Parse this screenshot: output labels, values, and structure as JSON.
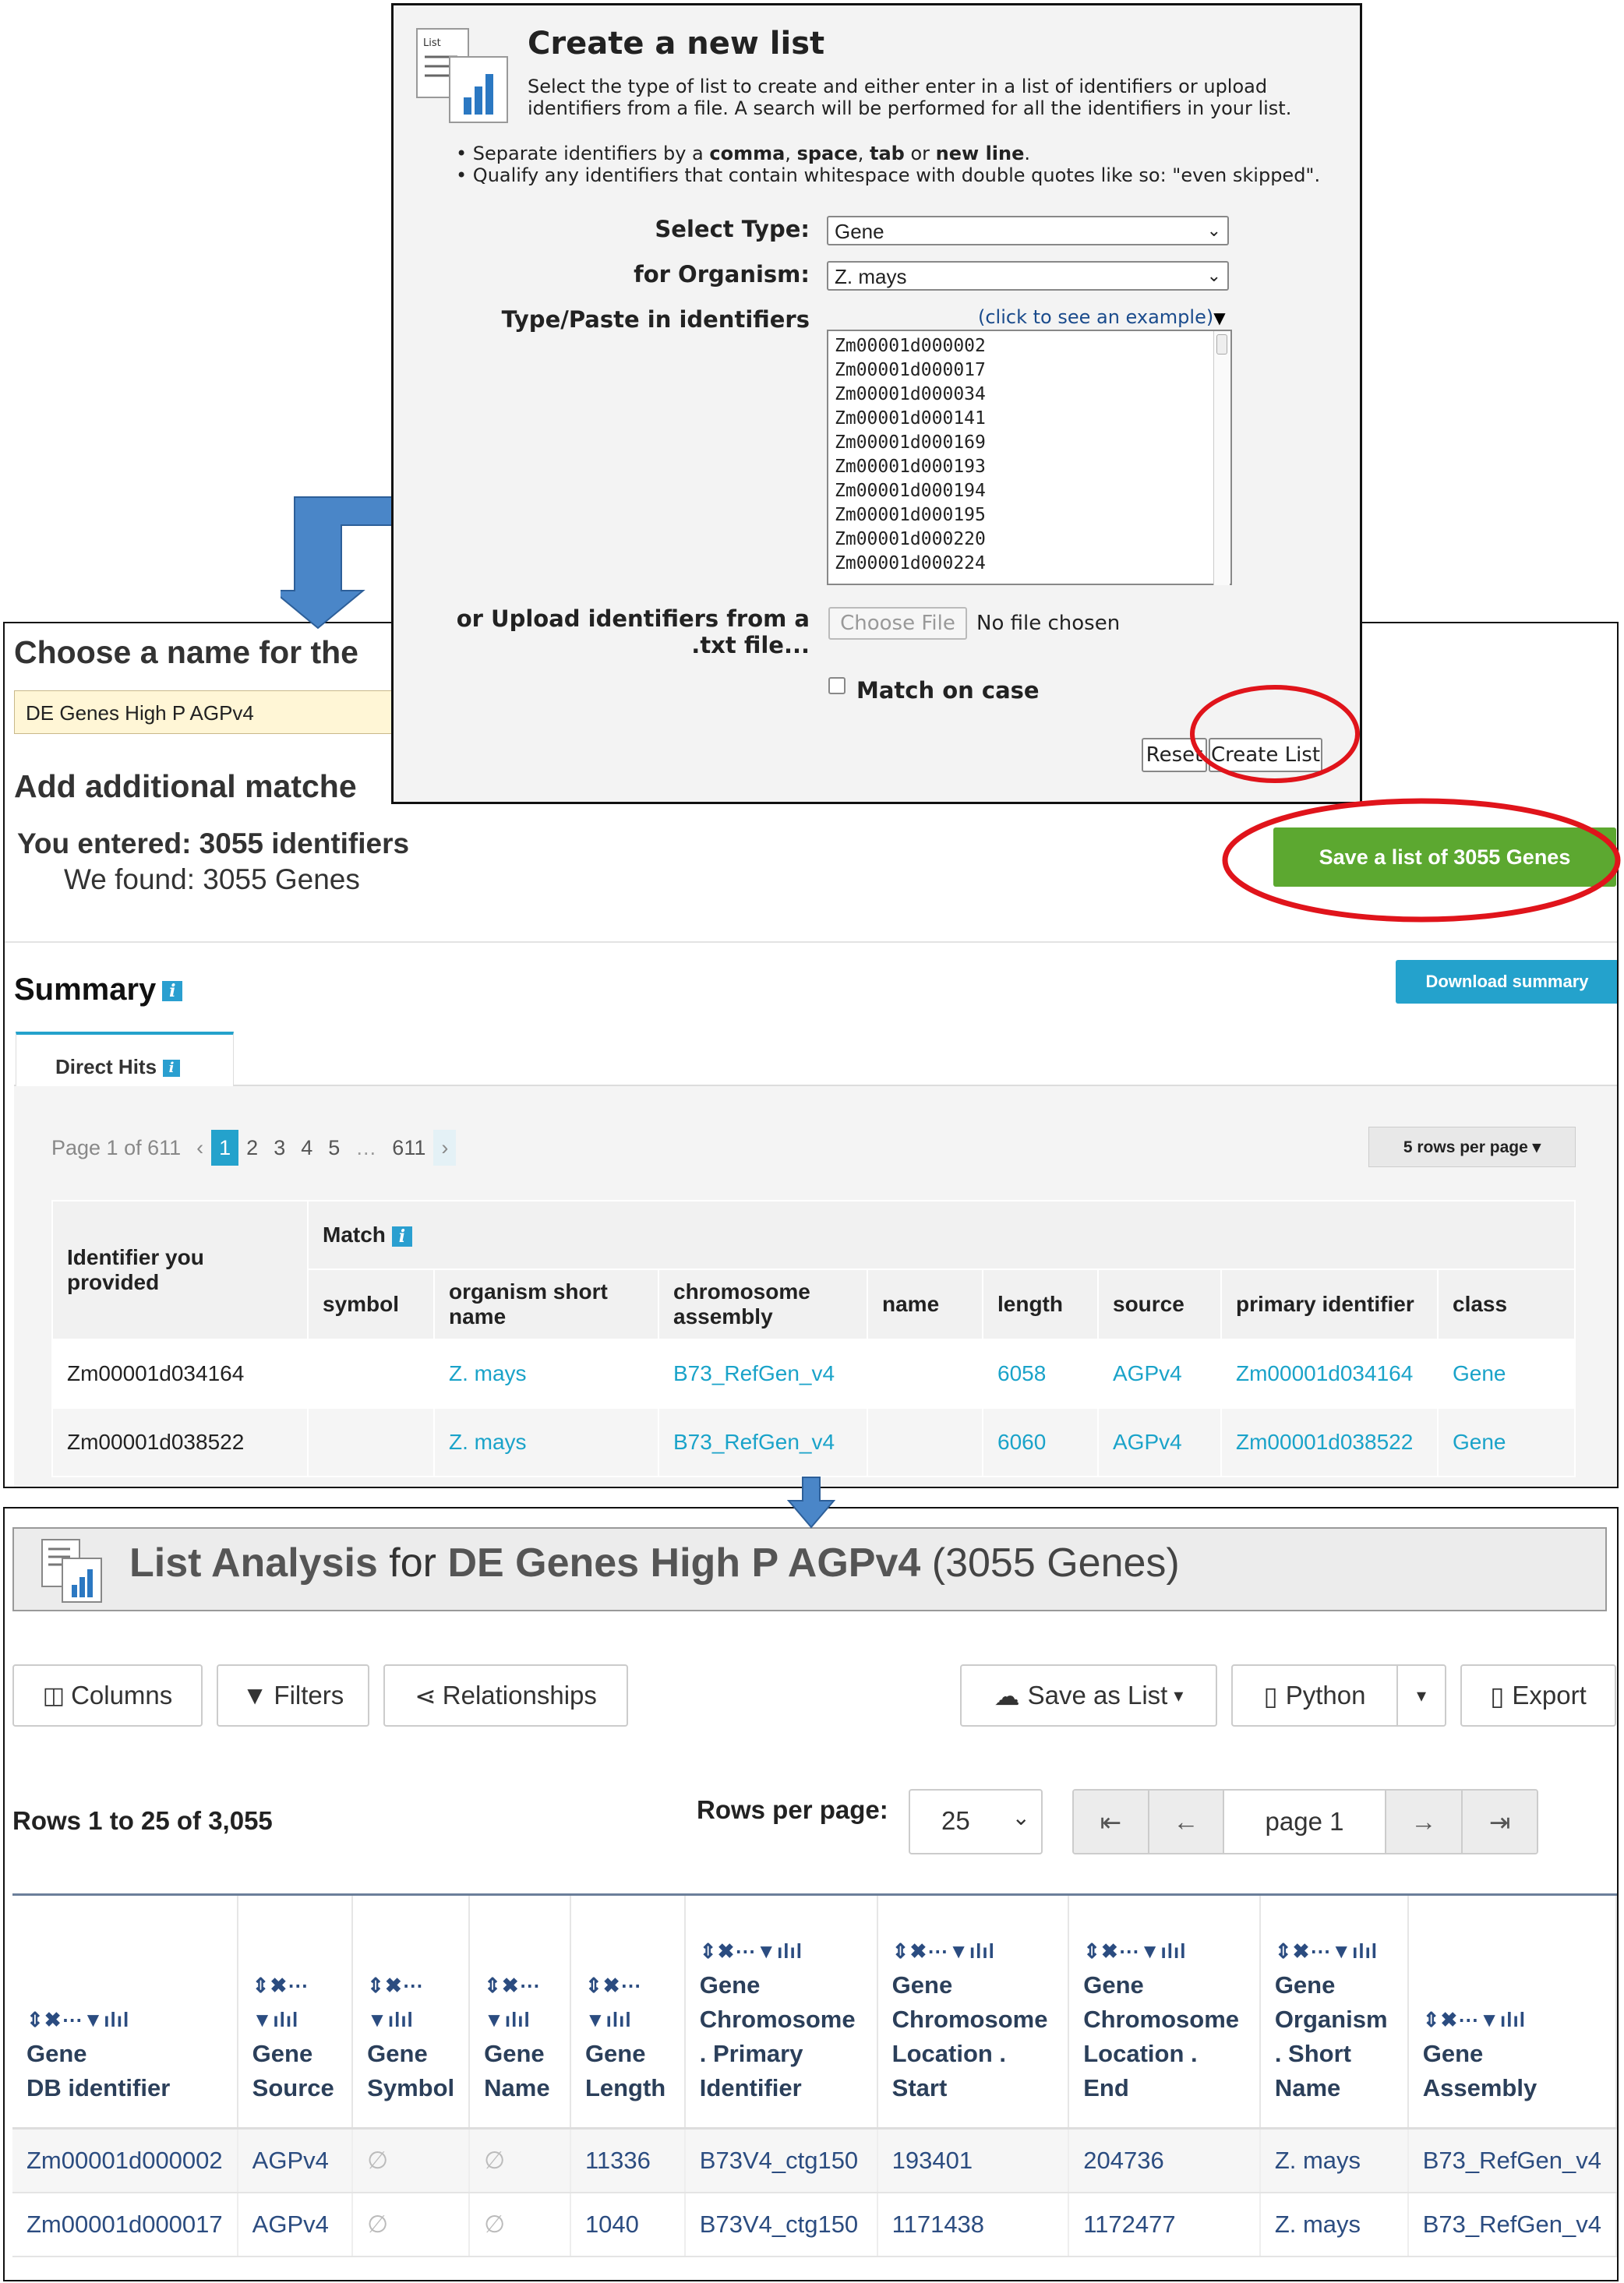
{
  "dialog": {
    "title": "Create a new list",
    "description": "Select the type of list to create and either enter in a list of identifiers or upload identifiers from a file. A search will be performed for all the identifiers in your list.",
    "bullet1_prefix": "Separate identifiers by a ",
    "bullet1_comma": "comma",
    "bullet1_space": "space",
    "bullet1_tab": "tab",
    "bullet1_or": " or ",
    "bullet1_newline": "new line",
    "bullet2": "Qualify any identifiers that contain whitespace with double quotes like so: \"even skipped\".",
    "select_type_label": "Select Type:",
    "select_type_value": "Gene",
    "organism_label": "for Organism:",
    "organism_value": "Z. mays",
    "paste_label": "Type/Paste in identifiers",
    "example_link": "(click to see an example)",
    "identifiers": [
      "Zm00001d000002",
      "Zm00001d000017",
      "Zm00001d000034",
      "Zm00001d000141",
      "Zm00001d000169",
      "Zm00001d000193",
      "Zm00001d000194",
      "Zm00001d000195",
      "Zm00001d000220",
      "Zm00001d000224"
    ],
    "upload_label_1": "or Upload identifiers from a",
    "upload_label_2": ".txt file...",
    "choose_file": "Choose File",
    "no_file": "No file chosen",
    "match_case": "Match on case",
    "reset": "Reset",
    "create_list": "Create List"
  },
  "upload": {
    "name_title": "Choose a name for the",
    "name_value": "DE Genes High P AGPv4",
    "add_title": "Add additional matche",
    "entered": "You entered: 3055 identifiers",
    "found": "We found: 3055 Genes",
    "save_button": "Save a list of 3055 Genes",
    "summary": "Summary",
    "download_summary": "Download summary",
    "tab": "Direct Hits",
    "page_info": "Page 1 of 611",
    "pages": [
      "1",
      "2",
      "3",
      "4",
      "5",
      "…",
      "611"
    ],
    "prev": "‹",
    "next": "›",
    "rows_per_page": "5 rows per page",
    "col_provided": "Identifier you provided",
    "col_match": "Match",
    "columns": [
      "symbol",
      "organism short name",
      "chromosome assembly",
      "name",
      "length",
      "source",
      "primary identifier",
      "class"
    ],
    "rows": [
      {
        "provided": "Zm00001d034164",
        "symbol": "",
        "organism": "Z. mays",
        "assembly": "B73_RefGen_v4",
        "name": "",
        "length": "6058",
        "source": "AGPv4",
        "primary": "Zm00001d034164",
        "class": "Gene"
      },
      {
        "provided": "Zm00001d038522",
        "symbol": "",
        "organism": "Z. mays",
        "assembly": "B73_RefGen_v4",
        "name": "",
        "length": "6060",
        "source": "AGPv4",
        "primary": "Zm00001d038522",
        "class": "Gene"
      }
    ]
  },
  "analysis": {
    "title_main": "List Analysis",
    "title_for": " for ",
    "list_name": "DE Genes High P AGPv4",
    "count": " (3055 Genes)",
    "btn_columns": "Columns",
    "btn_filters": "Filters",
    "btn_relationships": "Relationships",
    "btn_save_as_list": "Save as List",
    "btn_python": "Python",
    "btn_export": "Export",
    "rows_info": "Rows 1 to 25 of 3,055",
    "rows_per_page_label": "Rows per page:",
    "rows_per_page_value": "25",
    "page_value": "page 1",
    "nav_first": "⇤",
    "nav_prev": "←",
    "nav_next": "→",
    "nav_last": "⇥",
    "headers": [
      [
        "Gene",
        "DB identifier"
      ],
      [
        "Gene",
        "Source"
      ],
      [
        "Gene",
        "Symbol"
      ],
      [
        "Gene",
        "Name"
      ],
      [
        "Gene",
        "Length"
      ],
      [
        "Gene",
        "Chromosome",
        ". Primary",
        "Identifier"
      ],
      [
        "Gene",
        "Chromosome",
        "Location .",
        "Start"
      ],
      [
        "Gene",
        "Chromosome",
        "Location .",
        "End"
      ],
      [
        "Gene",
        "Organism",
        ". Short",
        "Name"
      ],
      [
        "Gene",
        "Assembly"
      ]
    ],
    "empty_glyph": "∅",
    "rows": [
      [
        "Zm00001d000002",
        "AGPv4",
        "",
        "",
        "11336",
        "B73V4_ctg150",
        "193401",
        "204736",
        "Z. mays",
        "B73_RefGen_v4"
      ],
      [
        "Zm00001d000017",
        "AGPv4",
        "",
        "",
        "1040",
        "B73V4_ctg150",
        "1171438",
        "1172477",
        "Z. mays",
        "B73_RefGen_v4"
      ]
    ]
  },
  "colors": {
    "accent_blue": "#24a2cc",
    "save_green": "#5ca830",
    "highlight_red": "#e0141b",
    "arrow_blue": "#4a86c8",
    "name_bg": "#fff6d6"
  }
}
